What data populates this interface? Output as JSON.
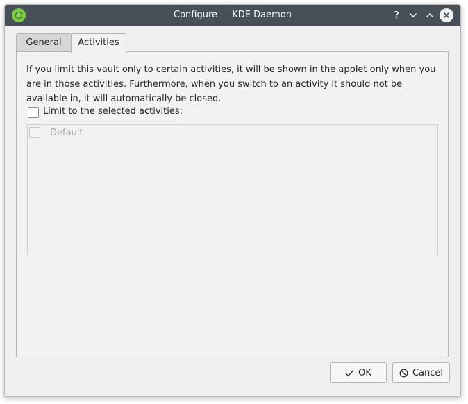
{
  "window": {
    "title": "Configure — KDE Daemon"
  },
  "titlebar": {
    "app_icon": "vault-icon",
    "help_glyph": "?"
  },
  "tabs": [
    {
      "label": "General",
      "active": false
    },
    {
      "label": "Activities",
      "active": true
    }
  ],
  "activities_page": {
    "description": "If you limit this vault only to certain activities, it will be shown in the applet only when you are in those activities. Furthermore, when you switch to an activity it should not be available in, it will automatically be closed.",
    "limit_checkbox": {
      "label": "Limit to the selected activities:",
      "checked": false
    },
    "activities": [
      {
        "label": "Default",
        "checked": false,
        "enabled": false
      }
    ]
  },
  "buttons": {
    "ok_label": "OK",
    "cancel_label": "Cancel"
  },
  "colors": {
    "titlebar": "#475057",
    "accent": "#3daee9",
    "app_icon": "#7ac943"
  }
}
